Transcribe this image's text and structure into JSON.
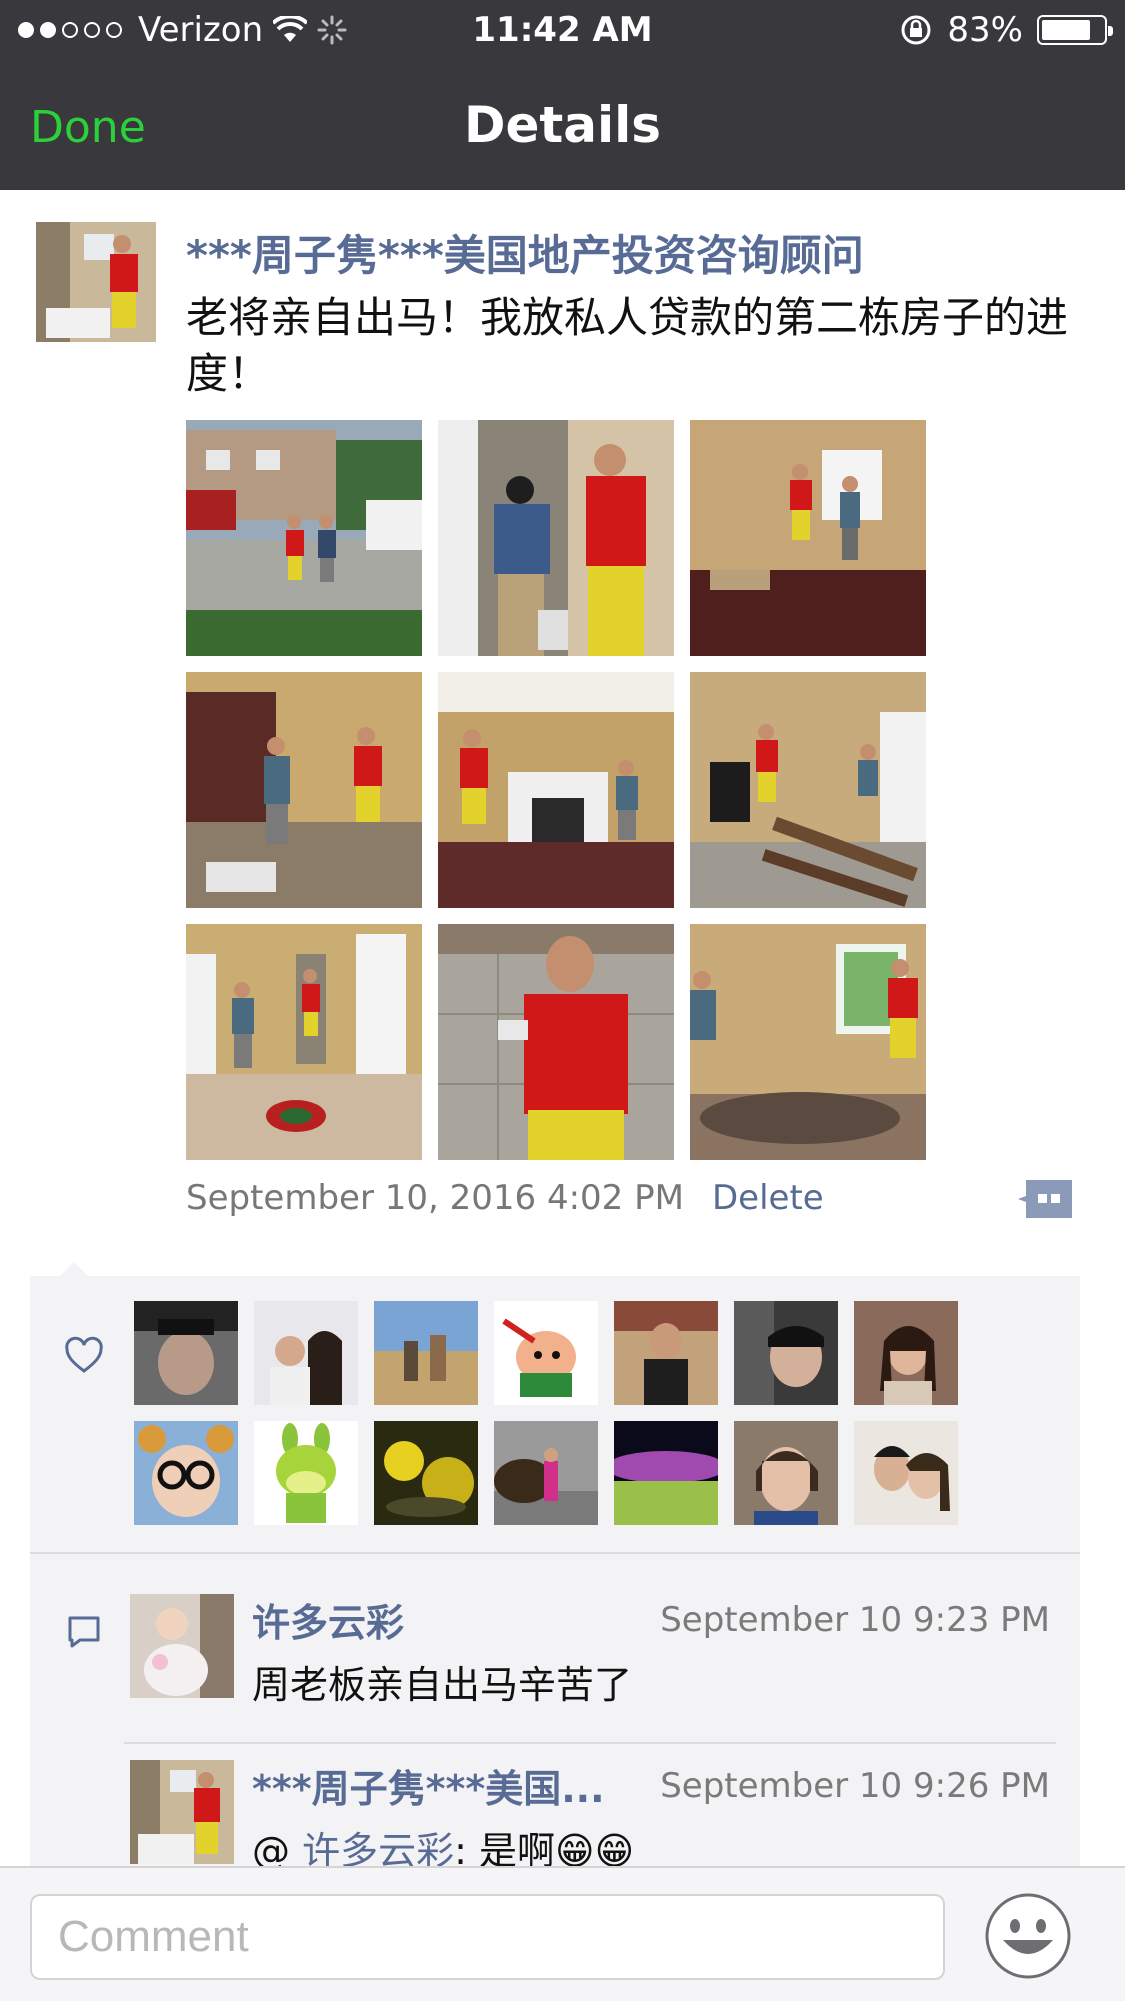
{
  "status_bar": {
    "carrier": "Verizon",
    "time": "11:42 AM",
    "battery": "83%",
    "battery_level": 0.83
  },
  "nav": {
    "done_label": "Done",
    "title": "Details"
  },
  "post": {
    "author": "***周子隽***美国地产投资咨询顾问",
    "text": "老将亲自出马！我放私人贷款的第二栋房子的进度！",
    "date": "September 10, 2016 4:02 PM",
    "delete_label": "Delete",
    "photo_count": 9
  },
  "likes": {
    "icon": "heart-icon",
    "avatar_count": 14
  },
  "comments": [
    {
      "name": "许多云彩",
      "time": "September 10 9:23 PM",
      "text": "周老板亲自出马辛苦了"
    },
    {
      "name": "***周子隽***美国...",
      "time": "September 10 9:26 PM",
      "prefix": "@ ",
      "mention": "许多云彩",
      "text": ": 是啊😁😁"
    }
  ],
  "input": {
    "placeholder": "Comment"
  },
  "colors": {
    "nav_bg": "#38383d",
    "done_green": "#2bd139",
    "link_blue": "#576b95"
  }
}
